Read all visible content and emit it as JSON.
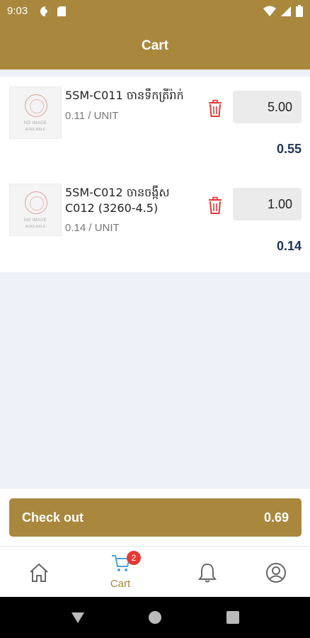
{
  "status_bar": {
    "time": "9:03",
    "left_icons": [
      "cloud-sync-icon",
      "sd-card-icon"
    ],
    "right_icons": [
      "wifi-icon",
      "cell-signal-icon",
      "battery-icon"
    ]
  },
  "app_bar": {
    "title": "Cart"
  },
  "cart": {
    "items": [
      {
        "thumb_line1": "NO IMAGE",
        "thumb_line2": "AVAILABLE",
        "name": "5SM-C011 ចានទឹកត្រីរ៉ាក់",
        "price": "0.11 / UNIT",
        "quantity": "5.00",
        "line_total": "0.55"
      },
      {
        "thumb_line1": "NO IMAGE",
        "thumb_line2": "AVAILABLE",
        "name": "5SM-C012 ចានចង្កឹស C012 (3260-4.5)",
        "price": "0.14 / UNIT",
        "quantity": "1.00",
        "line_total": "0.14"
      }
    ]
  },
  "checkout": {
    "label": "Check out",
    "total": "0.69"
  },
  "bottom_nav": {
    "home": {
      "icon": "home-icon"
    },
    "cart": {
      "icon": "cart-icon",
      "label": "Cart",
      "badge": "2"
    },
    "notifications": {
      "icon": "bell-icon"
    },
    "profile": {
      "icon": "user-icon"
    }
  },
  "colors": {
    "brand": "#a9883e",
    "total_text": "#1d3557",
    "delete": "#e53935",
    "badge": "#e53935"
  }
}
